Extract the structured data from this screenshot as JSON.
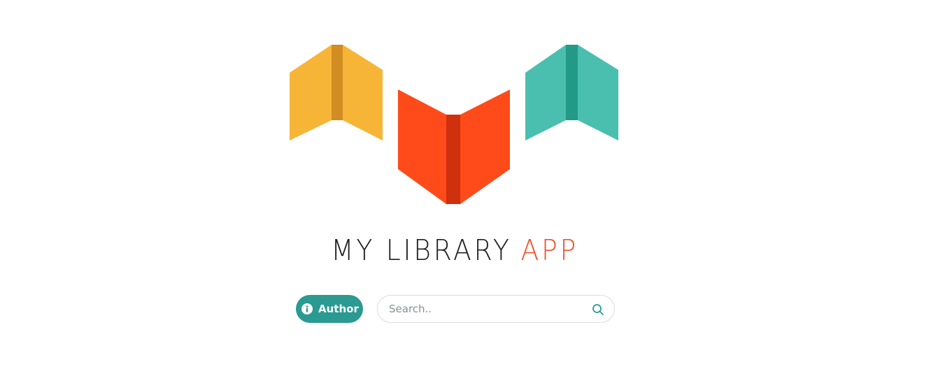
{
  "brand": {
    "title_main": "MY LIBRARY",
    "title_accent": "APP"
  },
  "author_button": {
    "label": "Author",
    "icon": "info-icon"
  },
  "search": {
    "placeholder": "Search..",
    "value": "",
    "icon": "search-icon"
  },
  "colors": {
    "yellow_book": "#f7b538",
    "yellow_spine": "#d18c22",
    "red_book": "#ff4b19",
    "red_spine": "#cf300e",
    "teal_book": "#4bbfaf",
    "teal_spine": "#239a88",
    "accent_text": "#f0512a",
    "button_bg": "#2a9a92"
  }
}
